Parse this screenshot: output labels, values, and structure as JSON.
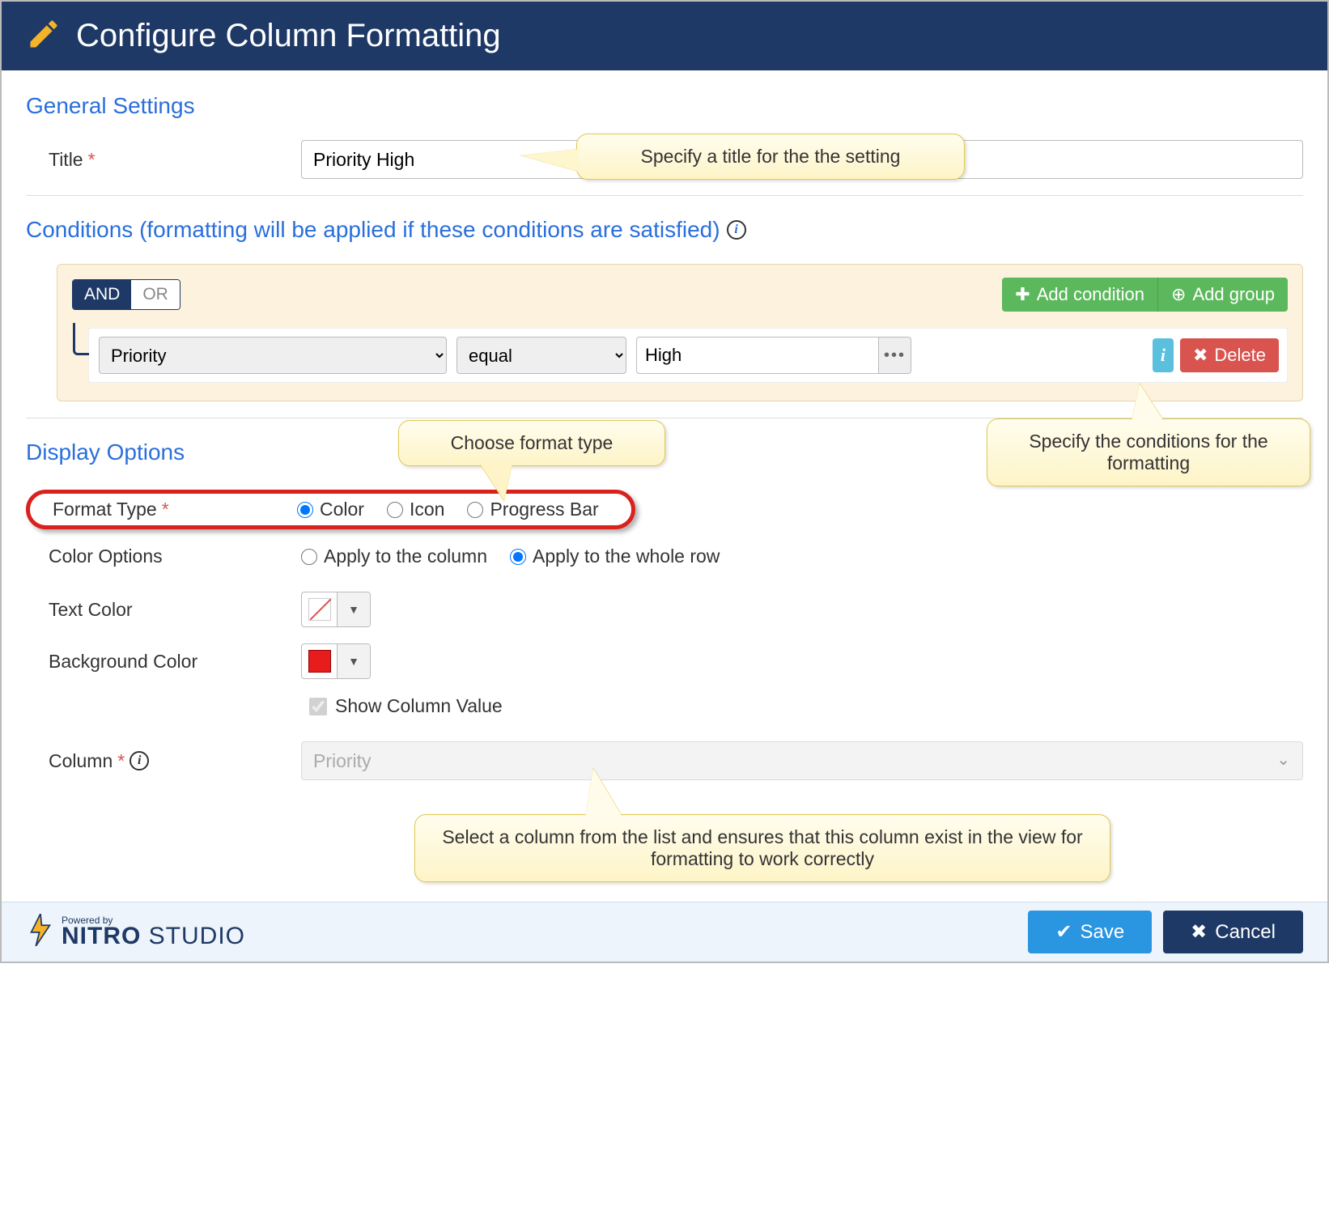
{
  "header": {
    "title": "Configure Column Formatting"
  },
  "sections": {
    "general": {
      "title": "General Settings"
    },
    "conditions": {
      "title": "Conditions (formatting will be applied if these conditions are satisfied)"
    },
    "display": {
      "title": "Display Options"
    }
  },
  "general": {
    "title_label": "Title",
    "title_value": "Priority High"
  },
  "conditions": {
    "logic": {
      "and": "AND",
      "or": "OR",
      "active": "AND"
    },
    "add_condition": "Add condition",
    "add_group": "Add group",
    "delete": "Delete",
    "row": {
      "field": "Priority",
      "operator": "equal",
      "value": "High"
    }
  },
  "display": {
    "format_type_label": "Format Type",
    "format_type": {
      "options": [
        "Color",
        "Icon",
        "Progress Bar"
      ],
      "selected": "Color"
    },
    "color_options_label": "Color Options",
    "color_options": {
      "options": [
        "Apply to the column",
        "Apply to the whole row"
      ],
      "selected": "Apply to the whole row"
    },
    "text_color_label": "Text Color",
    "text_color": "none",
    "background_color_label": "Background Color",
    "background_color": "#e71c1c",
    "show_column_value_label": "Show Column Value",
    "show_column_value": true,
    "column_label": "Column",
    "column_value": "Priority"
  },
  "callouts": {
    "title": "Specify a title for the the setting",
    "conditions": "Specify the conditions for the formatting",
    "format_type": "Choose format type",
    "column": "Select a column from the list and ensures that this column exist in the view for formatting to work correctly"
  },
  "footer": {
    "powered_by": "Powered by",
    "brand_bold": "NITRO",
    "brand_light": "STUDIO",
    "save": "Save",
    "cancel": "Cancel"
  }
}
